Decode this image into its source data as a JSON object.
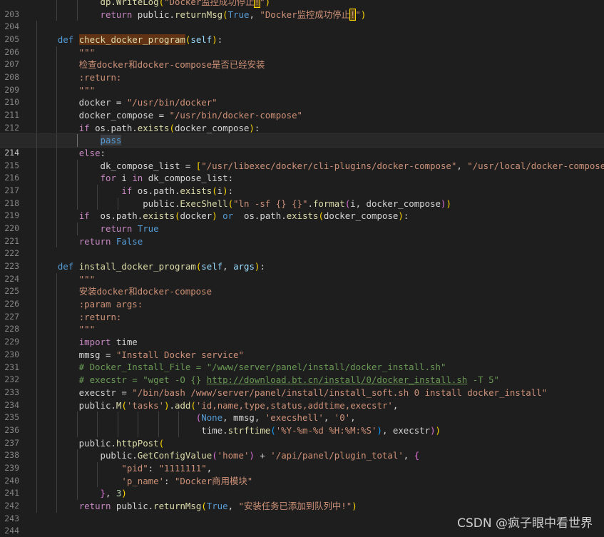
{
  "editor": {
    "lines": [
      {
        "n": "203",
        "text": "            dp.WriteLog(\"Docker监控成功停止!\")"
      },
      {
        "n": "204",
        "text": "            return public.returnMsg(True, \"Docker监控成功停止!\")"
      },
      {
        "n": "205",
        "text": ""
      },
      {
        "n": "206",
        "text": "    def check_docker_program(self):"
      },
      {
        "n": "207",
        "text": "        \"\"\""
      },
      {
        "n": "208",
        "text": "        检查docker和docker-compose是否已经安装"
      },
      {
        "n": "209",
        "text": "        :return:"
      },
      {
        "n": "210",
        "text": "        \"\"\""
      },
      {
        "n": "211",
        "text": "        docker = \"/usr/bin/docker\""
      },
      {
        "n": "212",
        "text": "        docker_compose = \"/usr/bin/docker-compose\""
      },
      {
        "n": "213",
        "text": "        if os.path.exists(docker_compose):"
      },
      {
        "n": "214",
        "text": "            pass"
      },
      {
        "n": "215",
        "text": "        else:"
      },
      {
        "n": "216",
        "text": "            dk_compose_list = [\"/usr/libexec/docker/cli-plugins/docker-compose\", \"/usr/local/docker-compose\"]"
      },
      {
        "n": "217",
        "text": "            for i in dk_compose_list:"
      },
      {
        "n": "218",
        "text": "                if os.path.exists(i):"
      },
      {
        "n": "219",
        "text": "                    public.ExecShell(\"ln -sf {} {}\".format(i, docker_compose))"
      },
      {
        "n": "220",
        "text": "        if  os.path.exists(docker) or  os.path.exists(docker_compose):"
      },
      {
        "n": "221",
        "text": "            return True"
      },
      {
        "n": "222",
        "text": "        return False"
      },
      {
        "n": "223",
        "text": ""
      },
      {
        "n": "224",
        "text": "    def install_docker_program(self, args):"
      },
      {
        "n": "225",
        "text": "        \"\"\""
      },
      {
        "n": "226",
        "text": "        安装docker和docker-compose"
      },
      {
        "n": "227",
        "text": "        :param args:"
      },
      {
        "n": "228",
        "text": "        :return:"
      },
      {
        "n": "229",
        "text": "        \"\"\""
      },
      {
        "n": "230",
        "text": "        import time"
      },
      {
        "n": "231",
        "text": "        mmsg = \"Install Docker service\""
      },
      {
        "n": "232",
        "text": "        # Docker_Install_File = \"/www/server/panel/install/docker_install.sh\""
      },
      {
        "n": "233",
        "text": "        # execstr = \"wget -O {} http://download.bt.cn/install/0/docker_install.sh -T 5\""
      },
      {
        "n": "234",
        "text": "        execstr = \"/bin/bash /www/server/panel/install/install_soft.sh 0 install docker_install\""
      },
      {
        "n": "235",
        "text": "        public.M('tasks').add('id,name,type,status,addtime,execstr',"
      },
      {
        "n": "236",
        "text": "                              (None, mmsg, 'execshell', '0',"
      },
      {
        "n": "237",
        "text": "                               time.strftime('%Y-%m-%d %H:%M:%S'), execstr))"
      },
      {
        "n": "238",
        "text": "        public.httpPost("
      },
      {
        "n": "239",
        "text": "            public.GetConfigValue('home') + '/api/panel/plugin_total', {"
      },
      {
        "n": "240",
        "text": "                \"pid\": \"1111111\","
      },
      {
        "n": "241",
        "text": "                'p_name': \"Docker商用模块\""
      },
      {
        "n": "242",
        "text": "            }, 3)"
      },
      {
        "n": "243",
        "text": "        return public.returnMsg(True, \"安装任务已添加到队列中!\")"
      },
      {
        "n": "244",
        "text": ""
      }
    ],
    "current_line": "214"
  },
  "watermark": {
    "text": "CSDN @疯子眼中看世界"
  },
  "colors": {
    "background": "#1e1e1e",
    "keyword": "#569cd6",
    "control": "#c586c0",
    "function": "#dcdcaa",
    "string": "#ce9178",
    "comment": "#6a9955",
    "param": "#9cdcfe",
    "number": "#b5cea8"
  }
}
